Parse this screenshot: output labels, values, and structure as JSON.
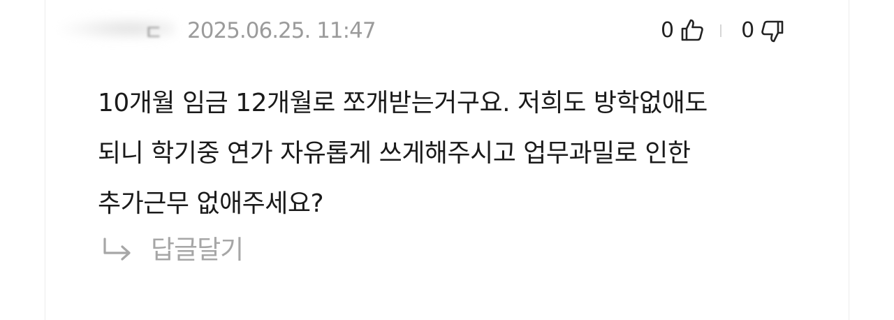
{
  "comment": {
    "author": "",
    "author_mark": "ㄷ",
    "date": "2025.06.25. 11:47",
    "likes": "0",
    "dislikes": "0",
    "body_lines": [
      "10개월 임금 12개월로 쪼개받는거구요. 저희도 방학없애도",
      "되니 학기중 연가 자유롭게 쓰게해주시고 업무과밀로 인한",
      "추가근무 없애주세요?"
    ],
    "reply_label": "답글달기"
  },
  "icons": {
    "like": "thumbs-up-icon",
    "dislike": "thumbs-down-icon",
    "reply": "reply-arrow-icon"
  },
  "colors": {
    "text": "#1a1a1a",
    "muted": "#9b9b9b",
    "reply": "#a6a6a6",
    "separator": "#d6d6d6"
  }
}
